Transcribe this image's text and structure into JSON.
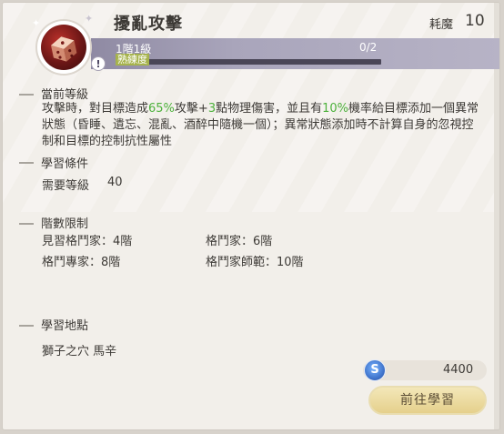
{
  "skill": {
    "name": "擾亂攻擊",
    "icon": "dice-icon",
    "cost_label": "耗魔",
    "cost_value": "10",
    "level_text": "1階1級",
    "progress_text": "0/2",
    "progress_fraction": 0,
    "proficiency_label": "熟練度",
    "info_glyph": "!"
  },
  "sections": {
    "current_level": {
      "title": "當前等級",
      "desc_1": "攻擊時，對目標造成",
      "pct_1": "65%",
      "desc_2": "攻擊+",
      "num_1": "3",
      "desc_3": "點物理傷害，並且有",
      "pct_2": "10%",
      "desc_4": "機率給目標添加一個異常狀態（昏睡、遺忘、混亂、酒醉中隨機一個）；異常狀態添加時不計算自身的忽視控制和目標的控制抗性屬性"
    },
    "learn_requirement": {
      "title": "學習條件",
      "label": "需要等級",
      "value": "40"
    },
    "rank_limit": {
      "title": "階數限制",
      "items": [
        "見習格鬥家：4階",
        "格鬥家：6階",
        "格鬥專家：8階",
        "格鬥家師範：10階"
      ]
    },
    "learn_location": {
      "title": "學習地點",
      "value": "獅子之穴 馬辛"
    }
  },
  "footer": {
    "coin_icon": "silver-coin-icon",
    "coin_glyph": "S",
    "coin_amount": "4400",
    "button_label": "前往學習"
  },
  "colors": {
    "highlight": "#4db13c",
    "button": "#e5d08c",
    "level_band": "#a9a5bb"
  }
}
